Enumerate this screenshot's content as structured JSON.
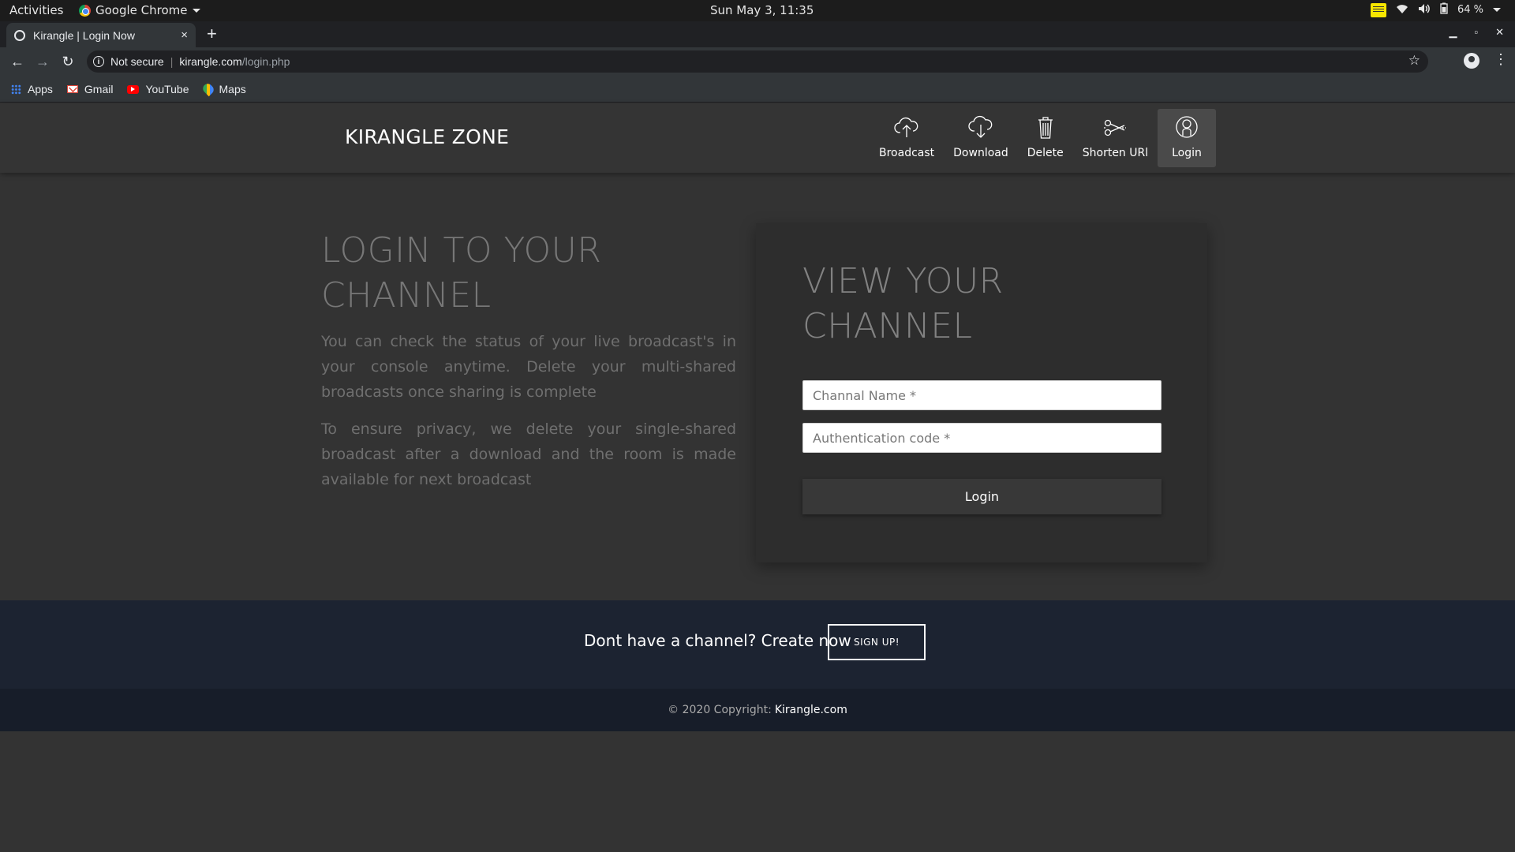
{
  "system_bar": {
    "activities": "Activities",
    "app_name": "Google Chrome",
    "clock": "Sun May  3, 11:35",
    "battery": "64 %"
  },
  "browser": {
    "tab_title": "Kirangle | Login Now",
    "tab_close": "×",
    "new_tab": "+",
    "security_label": "Not secure",
    "url_host": "kirangle.com",
    "url_path": "/login.php",
    "bookmarks": [
      {
        "label": "Apps",
        "icon": "apps-icon"
      },
      {
        "label": "Gmail",
        "icon": "gmail-icon"
      },
      {
        "label": "YouTube",
        "icon": "youtube-icon"
      },
      {
        "label": "Maps",
        "icon": "maps-icon"
      }
    ]
  },
  "site": {
    "brand": "KIRANGLE ZONE",
    "nav": [
      {
        "label": "Broadcast",
        "icon": "cloud-upload-icon"
      },
      {
        "label": "Download",
        "icon": "cloud-download-icon"
      },
      {
        "label": "Delete",
        "icon": "trash-icon"
      },
      {
        "label": "Shorten URl",
        "icon": "scissors-icon"
      },
      {
        "label": "Login",
        "icon": "user-icon",
        "active": true
      }
    ],
    "intro": {
      "title": "LOGIN TO YOUR CHANNEL",
      "paragraph_1": "You can check the status of your live broadcast's in your console anytime. Delete your multi-shared broadcasts once sharing is complete",
      "paragraph_2": "To ensure privacy, we delete your single-shared broadcast after a download and the room is made available for next broadcast"
    },
    "login_card": {
      "title": "VIEW YOUR CHANNEL",
      "channel_placeholder": "Channal Name *",
      "auth_placeholder": "Authentication code *",
      "submit_label": "Login"
    },
    "cta": {
      "text": "Dont have a channel? Create now",
      "button_label": "SIGN UP!"
    },
    "footer": {
      "copyright": "© 2020 Copyright:",
      "link_text": "Kirangle.com"
    }
  },
  "colors": {
    "page_bg": "#333333",
    "navbar_bg": "#343434",
    "card_bg": "#2d2d2d",
    "cta_bg": "#1c2331",
    "footer_bg": "#171d29"
  }
}
